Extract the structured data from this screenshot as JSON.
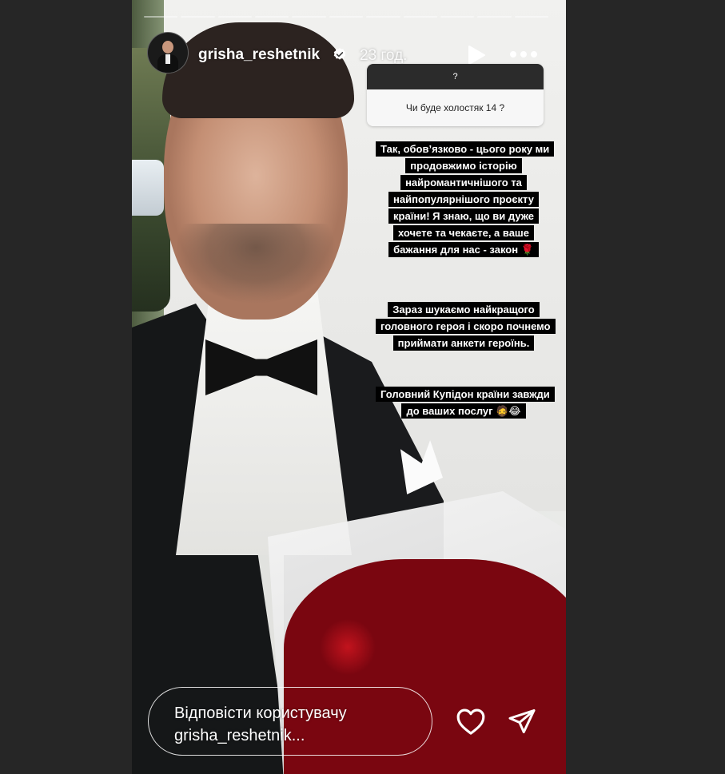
{
  "story": {
    "username": "grisha_reshetnik",
    "time": "23 год.",
    "progress_segments": 11,
    "question": {
      "header": "?",
      "text": "Чи буде холостяк 14 ?"
    },
    "captions": [
      "Так, обов’язково - цього року ми продовжимо історію найромантичнішого та найпопулярнішого проєкту країни! Я знаю, що ви дуже хочете та чекаєте, а ваше бажання для нас - закон 🌹",
      "Зараз шукаємо найкращого головного героя і скоро почнемо приймати анкети героїнь.",
      "Головний Купідон країни завжди до ваших послуг 🧔😂"
    ],
    "reply_placeholder": "Відповісти користувачу grisha_reshetnik..."
  },
  "icons": {
    "verified": "verified-badge-icon",
    "play": "play-icon",
    "more": "more-icon",
    "heart": "heart-icon",
    "send": "send-icon"
  },
  "colors": {
    "page_background": "#262626",
    "caption_background": "#000000"
  }
}
